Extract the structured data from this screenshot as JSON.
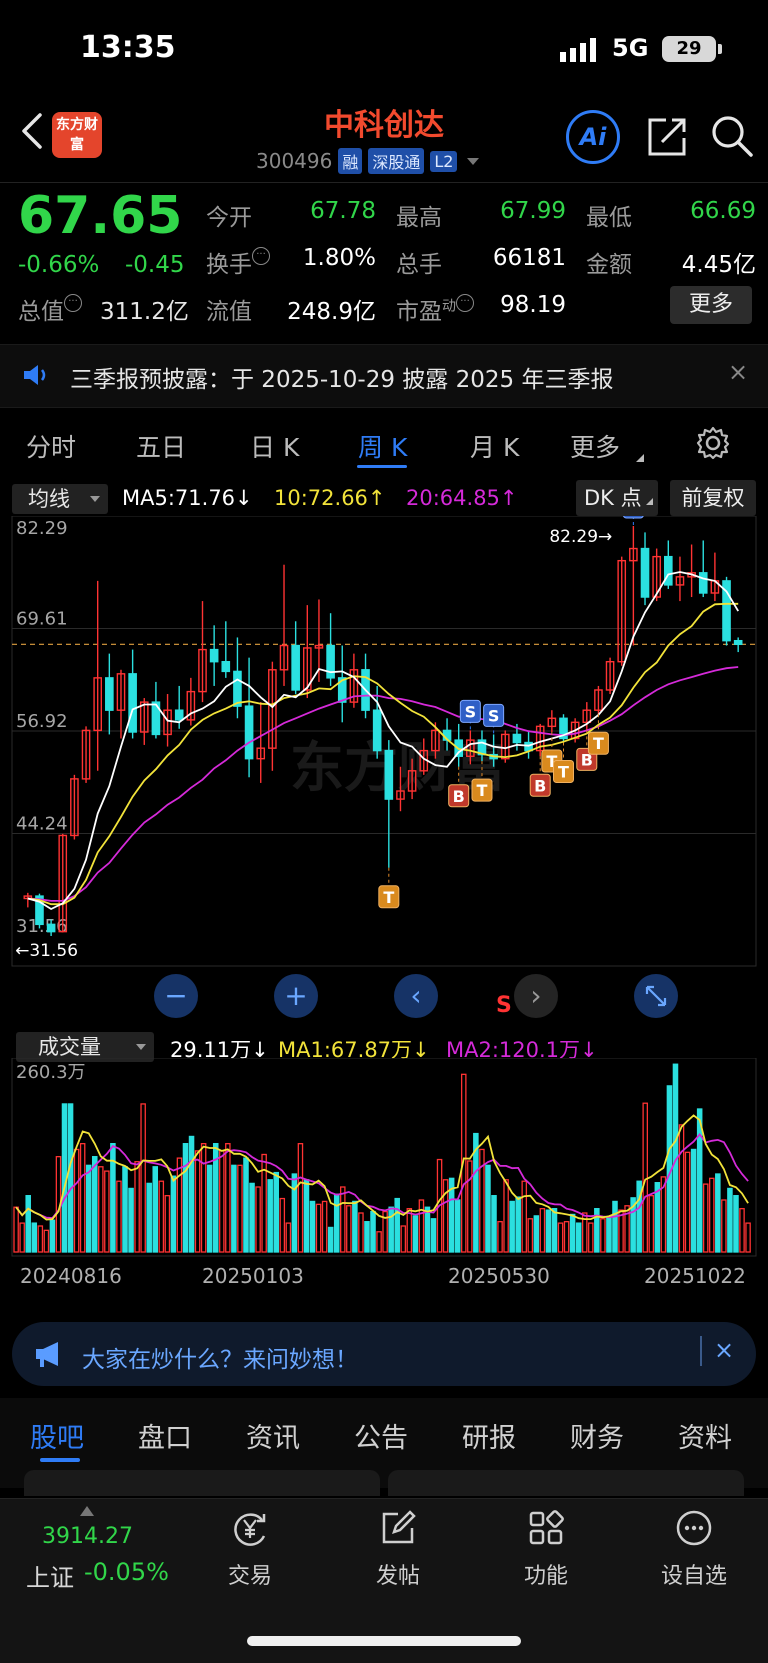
{
  "status_bar": {
    "time": "13:35",
    "network": "5G",
    "battery": "29"
  },
  "header": {
    "logo_text": "东方财富",
    "stock_name": "中科创达",
    "stock_code": "300496",
    "tags": [
      "融",
      "深股通",
      "L2"
    ],
    "ai_label": "Ai"
  },
  "quote": {
    "price": "67.65",
    "change_pct": "-0.66%",
    "change_val": "-0.45",
    "market_cap_label": "总值",
    "market_cap": "311.2亿",
    "fields": [
      {
        "label": "今开",
        "value": "67.78",
        "color": "green"
      },
      {
        "label": "最高",
        "value": "67.99",
        "color": "green"
      },
      {
        "label": "最低",
        "value": "66.69",
        "color": "green"
      },
      {
        "label": "换手",
        "value": "1.80%",
        "color": "white"
      },
      {
        "label": "总手",
        "value": "66181",
        "color": "white"
      },
      {
        "label": "金额",
        "value": "4.45亿",
        "color": "white"
      },
      {
        "label": "流值",
        "value": "248.9亿",
        "color": "white"
      },
      {
        "label": "市盈",
        "value": "98.19",
        "color": "white",
        "sup": "动"
      }
    ],
    "more_label": "更多"
  },
  "notice": {
    "text": "三季报预披露：于 2025-10-29 披露 2025 年三季报",
    "close": "×"
  },
  "period_tabs": [
    "分时",
    "五日",
    "日 K",
    "周 K",
    "月 K",
    "更多"
  ],
  "active_period": "周 K",
  "chart_header": {
    "ma_select": "均线",
    "ma5": "MA5:71.76",
    "ma10": "10:72.66",
    "ma20": "20:64.85",
    "dk_label": "DK 点",
    "fq_label": "前复权",
    "arrow_down": "↓",
    "arrow_up": "↑"
  },
  "colors": {
    "up": "#ff3333",
    "down": "#2be0e0",
    "ma5": "#ffffff",
    "ma10": "#f2e33a",
    "ma20": "#d52ad9",
    "accent": "#2f7cf6",
    "green": "#31d64a"
  },
  "chart_data": {
    "type": "candlestick",
    "y_tick_labels": [
      "82.29",
      "69.61",
      "56.92",
      "44.24",
      "31.56"
    ],
    "ylim": [
      31.56,
      82.29
    ],
    "max_annotation": "82.29→",
    "min_annotation": "←31.56",
    "current_price": 67.65,
    "candles": [
      [
        36.2,
        36.9,
        35.1,
        36.5
      ],
      [
        36.5,
        36.8,
        32.5,
        33.0
      ],
      [
        33.0,
        33.6,
        31.56,
        32.1
      ],
      [
        32.1,
        44.2,
        32.0,
        44.0
      ],
      [
        44.0,
        51.5,
        43.5,
        51.0
      ],
      [
        51.0,
        57.5,
        50.5,
        57.0
      ],
      [
        57.0,
        75.5,
        52.0,
        63.5
      ],
      [
        63.5,
        66.5,
        56.5,
        59.5
      ],
      [
        59.5,
        64.5,
        56.0,
        64.0
      ],
      [
        64.0,
        67.0,
        56.0,
        56.8
      ],
      [
        56.8,
        61.0,
        55.2,
        60.5
      ],
      [
        60.5,
        63.0,
        56.0,
        56.5
      ],
      [
        56.5,
        61.5,
        55.0,
        59.5
      ],
      [
        59.5,
        62.5,
        57.2,
        58.3
      ],
      [
        58.3,
        63.5,
        57.6,
        61.8
      ],
      [
        61.8,
        73.0,
        60.5,
        67.0
      ],
      [
        67.0,
        70.0,
        62.5,
        65.5
      ],
      [
        65.5,
        70.5,
        63.5,
        64.3
      ],
      [
        64.3,
        68.5,
        58.5,
        60.0
      ],
      [
        60.0,
        66.0,
        51.2,
        53.5
      ],
      [
        53.5,
        60.5,
        50.5,
        54.8
      ],
      [
        54.8,
        65.5,
        52.0,
        64.5
      ],
      [
        64.5,
        77.5,
        62.5,
        67.5
      ],
      [
        67.5,
        70.5,
        61.5,
        62.0
      ],
      [
        62.0,
        72.5,
        61.0,
        67.2
      ],
      [
        67.2,
        73.2,
        63.0,
        67.5
      ],
      [
        67.5,
        71.5,
        62.5,
        63.5
      ],
      [
        63.5,
        67.5,
        58.0,
        60.5
      ],
      [
        60.5,
        66.5,
        59.8,
        64.5
      ],
      [
        64.5,
        66.5,
        58.5,
        59.5
      ],
      [
        59.5,
        62.5,
        53.5,
        54.5
      ],
      [
        54.5,
        55.8,
        40.0,
        48.5
      ],
      [
        48.5,
        52.5,
        47.0,
        49.5
      ],
      [
        49.5,
        53.5,
        48.5,
        52.0
      ],
      [
        52.0,
        56.0,
        51.5,
        54.5
      ],
      [
        54.5,
        58.0,
        53.5,
        57.0
      ],
      [
        57.0,
        58.5,
        54.5,
        55.8
      ],
      [
        55.8,
        57.8,
        52.5,
        53.8
      ],
      [
        53.8,
        57.0,
        52.8,
        55.8
      ],
      [
        55.8,
        57.0,
        53.2,
        54.0
      ],
      [
        54.0,
        56.5,
        52.5,
        53.5
      ],
      [
        53.5,
        57.0,
        53.0,
        56.5
      ],
      [
        56.5,
        57.8,
        54.5,
        55.5
      ],
      [
        55.5,
        57.0,
        53.5,
        54.5
      ],
      [
        54.5,
        57.8,
        53.8,
        57.5
      ],
      [
        57.5,
        59.5,
        56.8,
        58.5
      ],
      [
        58.5,
        59.0,
        55.5,
        56.0
      ],
      [
        56.0,
        58.5,
        55.5,
        58.0
      ],
      [
        58.0,
        60.5,
        57.0,
        59.5
      ],
      [
        59.5,
        62.5,
        59.0,
        62.0
      ],
      [
        62.0,
        66.0,
        61.5,
        65.5
      ],
      [
        65.5,
        78.5,
        65.0,
        78.0
      ],
      [
        78.0,
        82.29,
        67.5,
        79.5
      ],
      [
        79.5,
        81.5,
        72.5,
        73.5
      ],
      [
        73.5,
        79.5,
        73.0,
        78.5
      ],
      [
        78.5,
        80.5,
        74.5,
        75.0
      ],
      [
        75.0,
        78.5,
        73.0,
        76.0
      ],
      [
        76.0,
        80.0,
        73.5,
        76.5
      ],
      [
        76.5,
        80.5,
        73.5,
        74.0
      ],
      [
        74.0,
        79.0,
        73.0,
        75.5
      ],
      [
        75.5,
        76.0,
        67.5,
        68.1
      ],
      [
        68.1,
        68.5,
        66.69,
        67.65
      ]
    ],
    "ma5": [
      36.2,
      35.8,
      34.9,
      35.6,
      37.4,
      41.0,
      46.7,
      50.1,
      55.0,
      59.6,
      60.2,
      60.2,
      58.2,
      58.0,
      59.1,
      59.7,
      60.6,
      62.4,
      63.3,
      62.5,
      61.1,
      59.9,
      61.4,
      61.1,
      62.3,
      64.6,
      64.2,
      64.3,
      63.6,
      62.0,
      60.5,
      57.5,
      55.5,
      55.0,
      53.5,
      52.7,
      52.5,
      54.3,
      55.3,
      55.5,
      55.0,
      54.8,
      55.2,
      55.1,
      55.6,
      56.0,
      56.4,
      57.0,
      57.8,
      58.9,
      60.6,
      64.3,
      68.6,
      71.6,
      73.9,
      76.3,
      76.6,
      76.3,
      75.8,
      75.5,
      74.2,
      71.76
    ],
    "ma10": [
      36.2,
      36.0,
      35.5,
      35.5,
      36.3,
      38.5,
      41.9,
      43.9,
      46.3,
      48.8,
      50.8,
      52.2,
      53.9,
      55.2,
      57.1,
      58.3,
      59.1,
      59.7,
      60.4,
      60.6,
      60.3,
      60.2,
      61.0,
      61.3,
      61.6,
      62.2,
      62.1,
      63.2,
      63.7,
      63.6,
      62.8,
      61.5,
      60.4,
      59.4,
      58.7,
      57.4,
      55.9,
      54.7,
      54.5,
      54.1,
      53.8,
      53.7,
      53.9,
      54.4,
      55.0,
      55.2,
      55.6,
      56.1,
      56.6,
      57.7,
      58.6,
      60.1,
      62.3,
      64.2,
      65.4,
      67.5,
      68.9,
      69.9,
      71.7,
      72.6,
      72.66,
      72.66
    ],
    "ma20": [
      36.2,
      36.1,
      35.9,
      35.9,
      36.5,
      37.6,
      39.4,
      40.6,
      42.4,
      44.1,
      45.6,
      46.6,
      47.8,
      48.7,
      49.9,
      50.9,
      52.3,
      53.3,
      54.5,
      55.5,
      56.3,
      57.1,
      57.9,
      58.5,
      59.1,
      59.7,
      60.2,
      60.7,
      61.2,
      61.3,
      61.3,
      61.0,
      60.9,
      60.6,
      60.2,
      59.9,
      59.3,
      58.7,
      58.6,
      58.4,
      58.3,
      57.8,
      57.3,
      56.9,
      56.7,
      56.5,
      56.4,
      56.6,
      57.0,
      57.5,
      58.2,
      59.0,
      60.1,
      61.1,
      62.0,
      62.7,
      63.2,
      63.6,
      64.0,
      64.4,
      64.7,
      64.85
    ],
    "signals": [
      {
        "label": "S",
        "index": 38,
        "pos": "above"
      },
      {
        "label": "S",
        "index": 40,
        "pos": "above"
      },
      {
        "label": "S",
        "index": 52,
        "pos": "above"
      },
      {
        "label": "B",
        "index": 37,
        "pos": "below"
      },
      {
        "label": "T",
        "index": 39,
        "pos": "below"
      },
      {
        "label": "T",
        "index": 31,
        "pos": "below"
      },
      {
        "label": "B",
        "index": 44,
        "pos": "below"
      },
      {
        "label": "T",
        "index": 45,
        "pos": "below"
      },
      {
        "label": "T",
        "index": 46,
        "pos": "below"
      },
      {
        "label": "B",
        "index": 48,
        "pos": "below"
      },
      {
        "label": "T",
        "index": 49,
        "pos": "below"
      }
    ],
    "s_marker": "S"
  },
  "volume": {
    "select": "成交量",
    "current": "29.11万",
    "ma1": "MA1:67.87万",
    "ma2": "MA2:120.1万",
    "arrow": "↓",
    "ymax_label": "260.3万",
    "ymax": 260.3,
    "bars": [
      62,
      40,
      78,
      40,
      36,
      30,
      44,
      132,
      205,
      205,
      142,
      150,
      120,
      132,
      118,
      112,
      150,
      98,
      118,
      88,
      125,
      205,
      95,
      118,
      98,
      78,
      105,
      130,
      150,
      160,
      140,
      150,
      120,
      150,
      140,
      150,
      120,
      120,
      130,
      95,
      90,
      135,
      100,
      110,
      74,
      40,
      108,
      150,
      100,
      70,
      66,
      70,
      34,
      80,
      90,
      64,
      70,
      54,
      42,
      56,
      28,
      56,
      62,
      74,
      36,
      60,
      50,
      72,
      62,
      46,
      128,
      100,
      102,
      72,
      246,
      126,
      164,
      142,
      120,
      78,
      42,
      100,
      70,
      76,
      98,
      46,
      50,
      60,
      58,
      60,
      40,
      42,
      52,
      40,
      54,
      40,
      60,
      46,
      48,
      70,
      58,
      64,
      75,
      98,
      206,
      78,
      96,
      104,
      230,
      260,
      176,
      138,
      142,
      198,
      94,
      102,
      108,
      72,
      88,
      78,
      60,
      40
    ]
  },
  "dates": [
    "20240816",
    "20250103",
    "20250530",
    "20251022"
  ],
  "controls": {
    "zoom_out": "−",
    "zoom_in": "+",
    "prev": "‹",
    "next": "›"
  },
  "ask_bar": {
    "text": "大家在炒什么？来问妙想！",
    "close": "×"
  },
  "bottom_tabs": [
    "股吧",
    "盘口",
    "资讯",
    "公告",
    "研报",
    "财务",
    "资料"
  ],
  "active_bottom_tab": "股吧",
  "index": {
    "value": "3914.27",
    "name": "上证",
    "change": "-0.05%"
  },
  "nav": [
    {
      "label": "交易",
      "icon": "yen-circle-icon"
    },
    {
      "label": "发帖",
      "icon": "edit-icon"
    },
    {
      "label": "功能",
      "icon": "grid-icon"
    },
    {
      "label": "设自选",
      "icon": "more-circle-icon"
    }
  ]
}
